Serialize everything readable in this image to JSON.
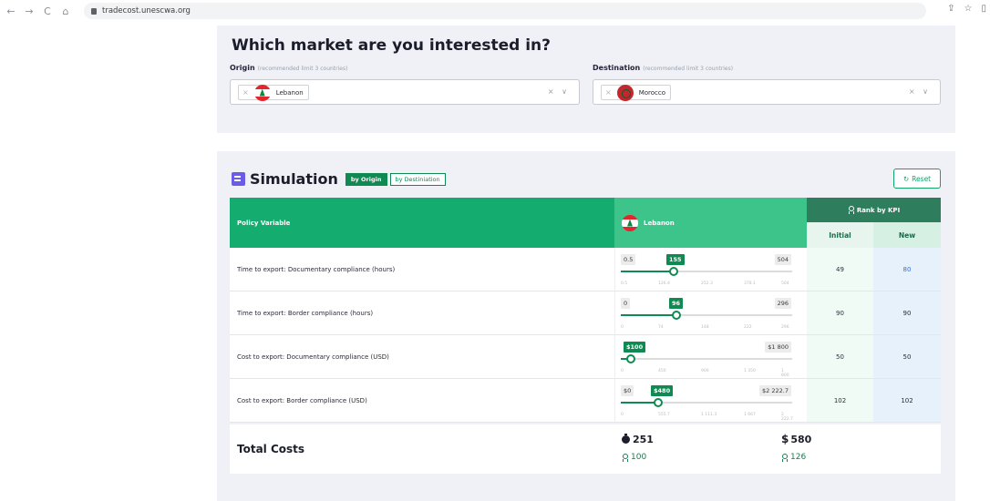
{
  "browser": {
    "url": "tradecost.unescwa.org",
    "back": "←",
    "forward": "→",
    "reload": "C",
    "home": "⌂",
    "share": "⇪",
    "star": "☆",
    "menu": "▯"
  },
  "market": {
    "title": "Which market are you interested in?",
    "origin_label": "Origin",
    "origin_hint": "(recommended limit 3 countries)",
    "origin_value": "Lebanon",
    "destination_label": "Destination",
    "destination_hint": "(recommended limit 3 countries)",
    "destination_value": "Morocco",
    "chip_remove": "×",
    "select_controls": "× ∨"
  },
  "simulation": {
    "title": "Simulation",
    "toggle_origin": "by Origin",
    "toggle_destination": "by Destiniation",
    "reset_label": "Reset",
    "reset_icon": "↻"
  },
  "table": {
    "col_policy": "Policy Variable",
    "col_country": "Lebanon",
    "col_rank": "Rank by KPI",
    "col_initial": "Initial",
    "col_new": "New",
    "rows": [
      {
        "label": "Time to export: Documentary compliance (hours)",
        "min": "0.5",
        "current": "155",
        "max": "504",
        "fraction": 0.307,
        "ticks": [
          "0.5",
          "126.4",
          "252.3",
          "378.1",
          "504"
        ],
        "initial": "49",
        "new": "80",
        "changed": true
      },
      {
        "label": "Time to export: Border compliance (hours)",
        "min": "0",
        "current": "96",
        "max": "296",
        "fraction": 0.324,
        "ticks": [
          "0",
          "74",
          "148",
          "222",
          "296"
        ],
        "initial": "90",
        "new": "90",
        "changed": false
      },
      {
        "label": "Cost to export: Documentary compliance (USD)",
        "min": "",
        "current": "$100",
        "max": "$1 800",
        "fraction": 0.056,
        "ticks": [
          "0",
          "450",
          "900",
          "1 350",
          "1 800"
        ],
        "initial": "50",
        "new": "50",
        "changed": false
      },
      {
        "label": "Cost to export: Border compliance (USD)",
        "min": "$0",
        "current": "$480",
        "max": "$2 222.7",
        "fraction": 0.216,
        "ticks": [
          "0",
          "555.7",
          "1 111.3",
          "1 667",
          "2 222.7"
        ],
        "initial": "102",
        "new": "102",
        "changed": false
      }
    ]
  },
  "totals": {
    "label": "Total Costs",
    "time_value": "251",
    "time_rank": "100",
    "cost_symbol": "$",
    "cost_value": "580",
    "cost_rank": "126"
  },
  "colors": {
    "primary_green": "#15ac6f",
    "dark_green": "#0f8a52",
    "rank_header": "#2e7d5c",
    "changed_value": "#2f6fe0",
    "panel_bg": "#eff1f6",
    "sim_icon": "#6a5ce6"
  }
}
